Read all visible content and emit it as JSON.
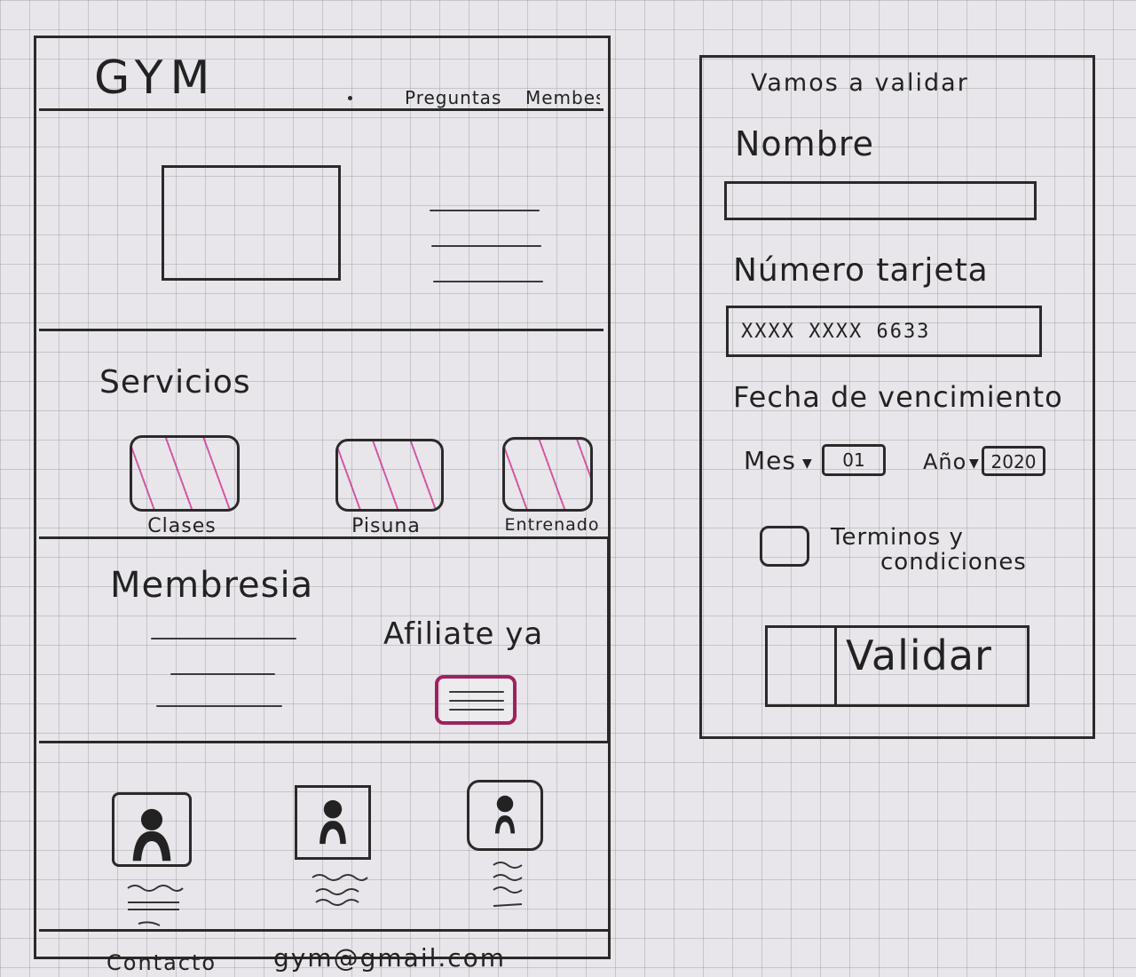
{
  "gym_page": {
    "logo": "GYM",
    "nav": {
      "questions": "Preguntas",
      "membership": "Membes"
    },
    "services": {
      "title": "Servicios",
      "items": [
        {
          "label": "Clases"
        },
        {
          "label": "Pisuna"
        },
        {
          "label": "Entrenado"
        }
      ]
    },
    "membership": {
      "title": "Membresia",
      "cta": "Afiliate ya"
    },
    "footer": {
      "contact_label": "Contacto",
      "email": "gym@gmail.com"
    }
  },
  "validation_form": {
    "title": "Vamos a validar",
    "name_label": "Nombre",
    "name_value": "",
    "card_label": "Número tarjeta",
    "card_value": "XXXX XXXX 6633",
    "expiry_label": "Fecha de vencimiento",
    "month_label": "Mes",
    "month_value": "01",
    "year_label": "Año",
    "year_value": "2020",
    "terms_label_1": "Terminos y",
    "terms_label_2": "condiciones",
    "submit_label": "Validar"
  },
  "colors": {
    "ink": "#2a2a2a",
    "highlight": "#cc288c",
    "button_border": "#a0205e"
  }
}
